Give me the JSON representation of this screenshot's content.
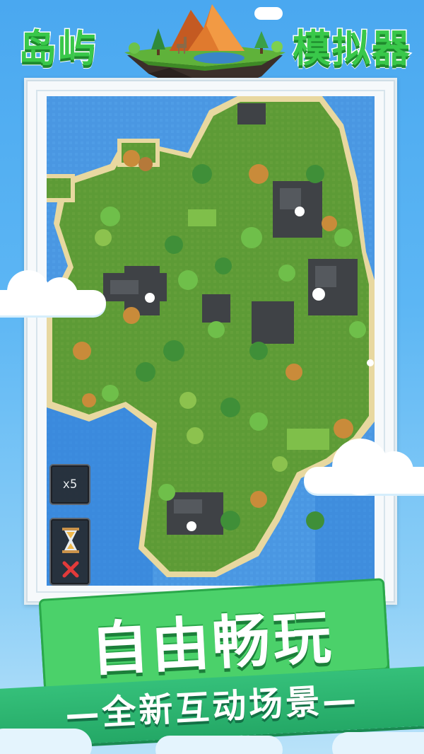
{
  "title": {
    "left": "岛屿",
    "right": "模拟器",
    "logo_icon": "floating-island-logo"
  },
  "game": {
    "speed_label": "x5",
    "time_icon": "hourglass-icon",
    "cancel_icon": "close-icon"
  },
  "slogan": {
    "main": "自由畅玩",
    "sub": "—全新互动场景—"
  },
  "colors": {
    "title_green": "#39c84a",
    "banner_green": "#4bd16a",
    "ocean": "#3d8de0",
    "grass": "#5a9a35",
    "sand": "#e8d8a0"
  }
}
